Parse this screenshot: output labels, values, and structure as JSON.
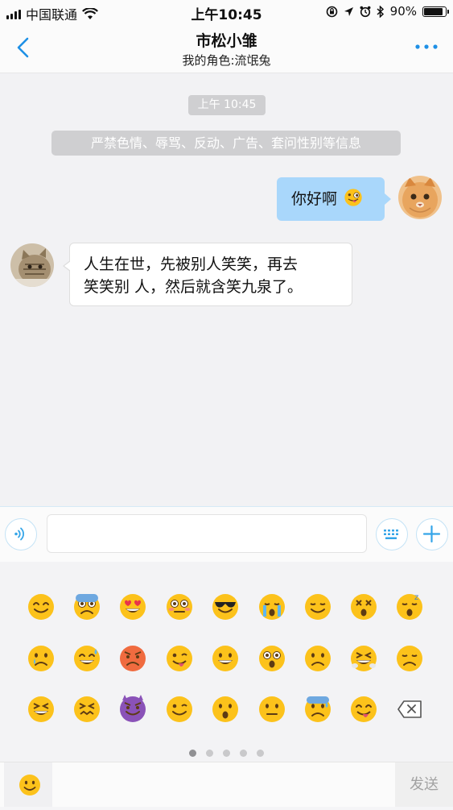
{
  "status_bar": {
    "carrier": "中国联通",
    "time": "上午10:45",
    "battery_percent": "90%",
    "battery_level": 0.9
  },
  "header": {
    "title": "市松小雏",
    "subtitle": "我的角色:流氓兔",
    "accent_color": "#1e90e6"
  },
  "chat": {
    "timestamp": "上午 10:45",
    "notice": "严禁色情、辱骂、反动、广告、套问性别等信息",
    "messages": [
      {
        "side": "right",
        "text": "你好啊",
        "emoji": "winking-tongue-emoji"
      },
      {
        "side": "left",
        "line1": "人生在世，先被别人笑笑，再去",
        "line2": "笑笑别 人，然后就含笑九泉了。"
      }
    ]
  },
  "input_bar": {
    "icons": [
      "voice-icon",
      "keyboard-icon",
      "plus-icon"
    ]
  },
  "emoji_panel": {
    "page": 1,
    "pages": 5,
    "rows": [
      [
        "smiling-face",
        "fearful-face",
        "heart-eyes",
        "flushed-face",
        "sunglasses-face",
        "loudly-crying-face",
        "relieved-face",
        "dizzy-face",
        "sleeping-face"
      ],
      [
        "crying-face",
        "sweat-smile-face",
        "angry-face",
        "winking-tongue-face",
        "grinning-face",
        "astonished-face",
        "worried-face",
        "triumph-face",
        "disappointed-face"
      ],
      [
        "tired-face",
        "confounded-face",
        "smiling-devil",
        "winking-face",
        "hushed-face",
        "confused-face",
        "cold-sweat-face",
        "yum-face",
        "backspace-key"
      ]
    ]
  },
  "bottom_bar": {
    "send_label": "发送"
  }
}
